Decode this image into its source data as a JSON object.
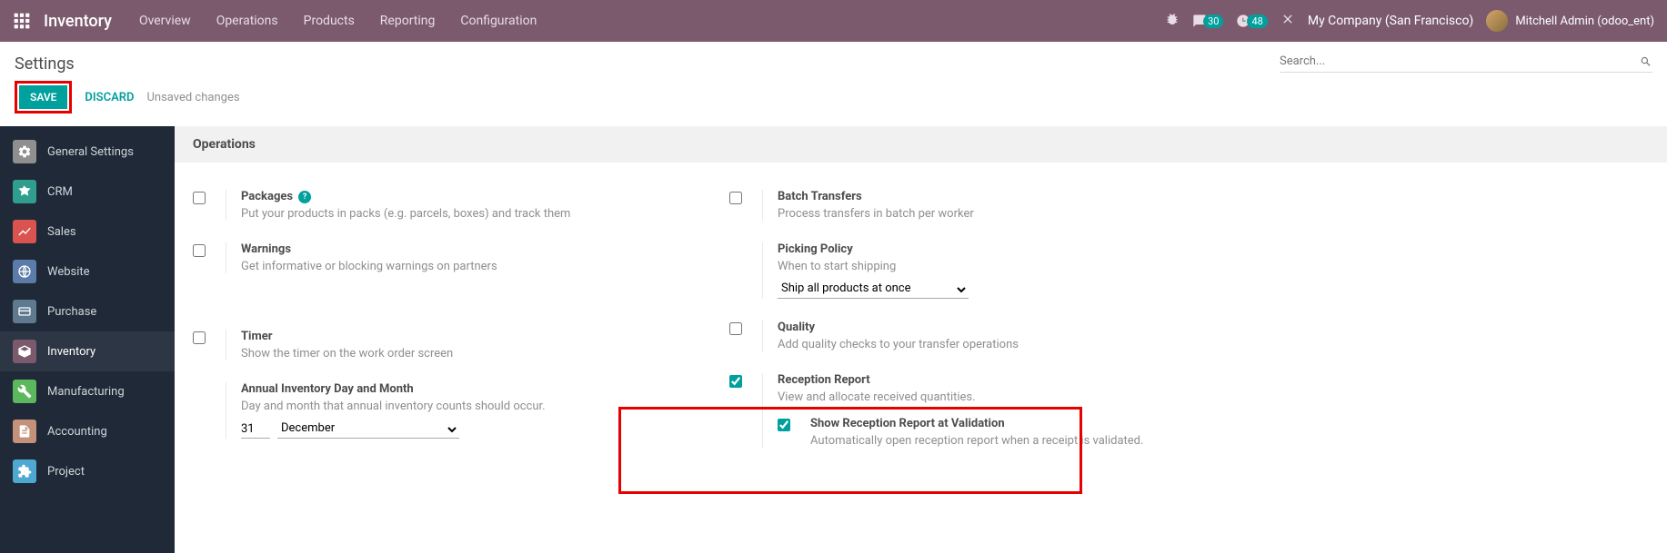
{
  "topnav": {
    "brand": "Inventory",
    "items": [
      "Overview",
      "Operations",
      "Products",
      "Reporting",
      "Configuration"
    ],
    "chat_count": "30",
    "clock_count": "48",
    "company": "My Company (San Francisco)",
    "user": "Mitchell Admin (odoo_ent)"
  },
  "page": {
    "title": "Settings",
    "search_placeholder": "Search...",
    "save_label": "SAVE",
    "discard_label": "DISCARD",
    "unsaved_label": "Unsaved changes"
  },
  "sidebar": {
    "items": [
      {
        "label": "General Settings"
      },
      {
        "label": "CRM"
      },
      {
        "label": "Sales"
      },
      {
        "label": "Website"
      },
      {
        "label": "Purchase"
      },
      {
        "label": "Inventory"
      },
      {
        "label": "Manufacturing"
      },
      {
        "label": "Accounting"
      },
      {
        "label": "Project"
      }
    ]
  },
  "section": {
    "title": "Operations"
  },
  "settings": {
    "packages": {
      "title": "Packages",
      "desc": "Put your products in packs (e.g. parcels, boxes) and track them"
    },
    "warnings": {
      "title": "Warnings",
      "desc": "Get informative or blocking warnings on partners"
    },
    "timer": {
      "title": "Timer",
      "desc": "Show the timer on the work order screen"
    },
    "annual": {
      "title": "Annual Inventory Day and Month",
      "desc": "Day and month that annual inventory counts should occur.",
      "day": "31",
      "month": "December"
    },
    "batch": {
      "title": "Batch Transfers",
      "desc": "Process transfers in batch per worker"
    },
    "picking": {
      "title": "Picking Policy",
      "desc": "When to start shipping",
      "option": "Ship all products at once"
    },
    "quality": {
      "title": "Quality",
      "desc": "Add quality checks to your transfer operations"
    },
    "reception": {
      "title": "Reception Report",
      "desc": "View and allocate received quantities.",
      "sub_title": "Show Reception Report at Validation",
      "sub_desc": "Automatically open reception report when a receipt is validated."
    }
  }
}
